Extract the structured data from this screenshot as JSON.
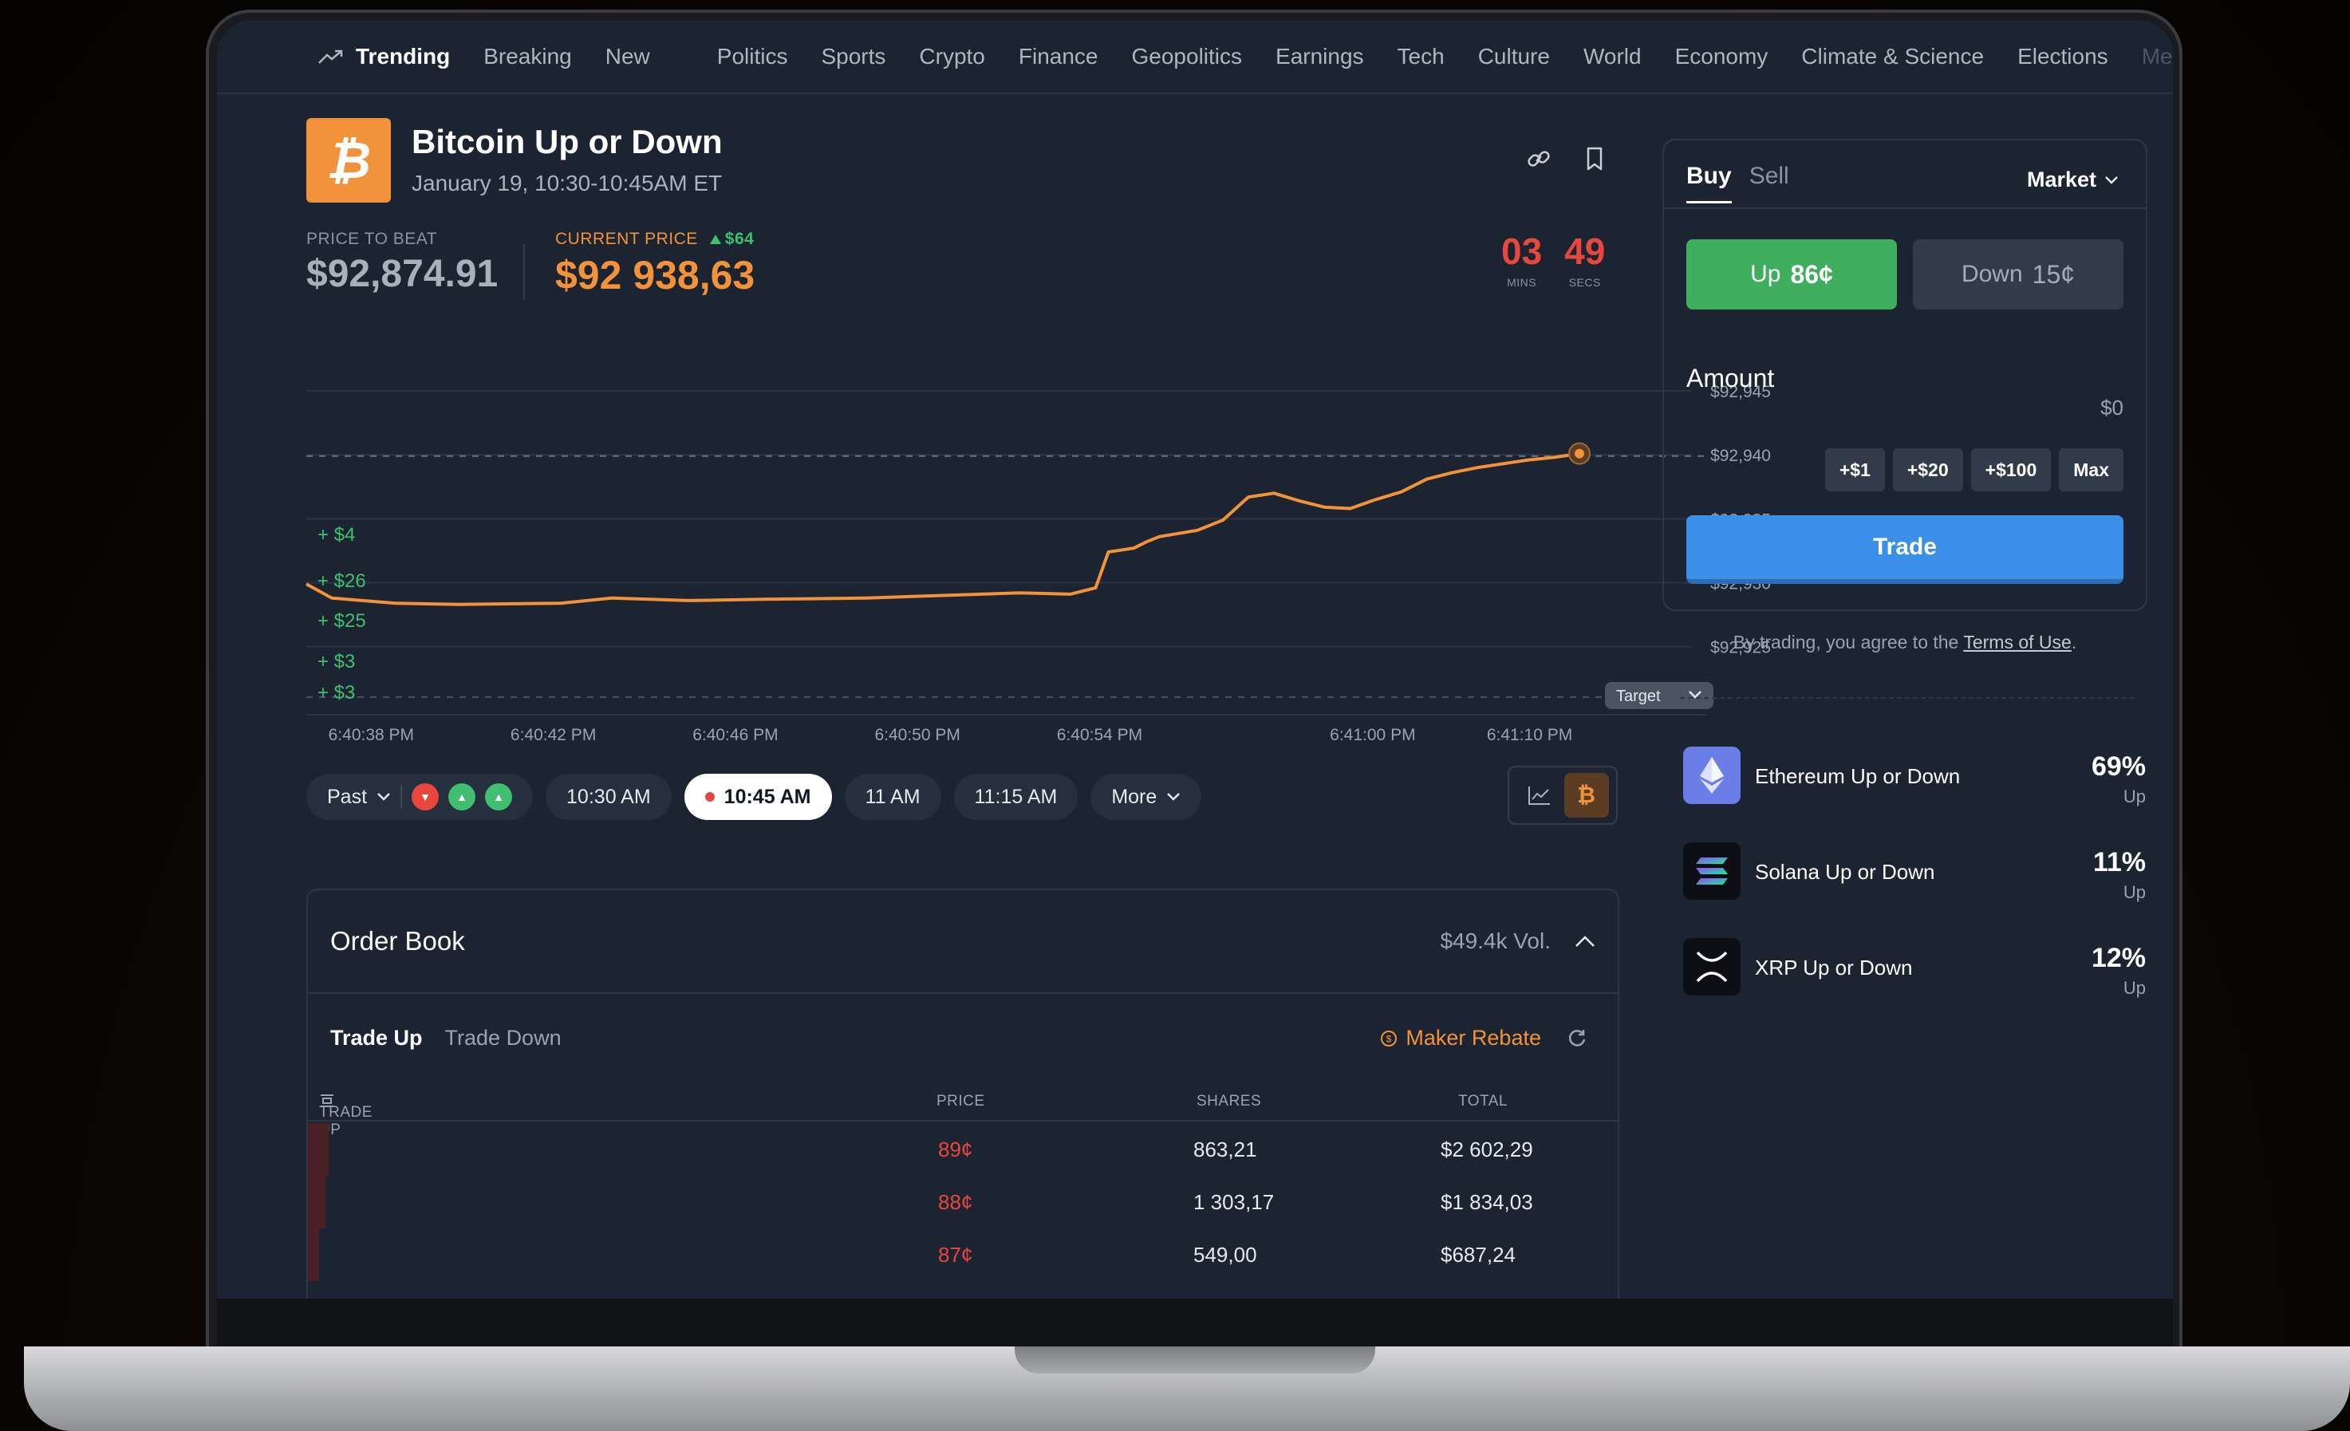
{
  "nav": {
    "items": [
      "Trending",
      "Breaking",
      "New",
      "Politics",
      "Sports",
      "Crypto",
      "Finance",
      "Geopolitics",
      "Earnings",
      "Tech",
      "Culture",
      "World",
      "Economy",
      "Climate & Science",
      "Elections",
      "Me"
    ]
  },
  "market": {
    "title": "Bitcoin Up or Down",
    "subtitle": "January 19, 10:30-10:45AM ET",
    "logo_glyph": "₿",
    "price_to_beat_label": "PRICE TO BEAT",
    "price_to_beat": "$92,874.91",
    "current_price_label": "CURRENT PRICE",
    "current_delta": "$64",
    "current_price": "$92 938,63",
    "countdown": {
      "mins": "03",
      "mins_label": "MINS",
      "secs": "49",
      "secs_label": "SECS"
    }
  },
  "chart_data": {
    "type": "line",
    "y_ticks": [
      "$92,945",
      "$92,940",
      "$92,935",
      "$92,930",
      "$92,925"
    ],
    "y_tick_values": [
      92945,
      92940,
      92935,
      92930,
      92925
    ],
    "x_ticks": [
      "6:40:38 PM",
      "6:40:42 PM",
      "6:40:46 PM",
      "6:40:50 PM",
      "6:40:54 PM",
      "6:41:00 PM",
      "6:41:10 PM"
    ],
    "target_label": "Target",
    "trade_labels": [
      "+ $4",
      "+ $26",
      "+ $25",
      "+ $3",
      "+ $3"
    ],
    "series": [
      {
        "color": "#f2923a",
        "x": [
          0,
          0.02,
          0.07,
          0.12,
          0.2,
          0.24,
          0.3,
          0.36,
          0.44,
          0.5,
          0.56,
          0.6,
          0.62,
          0.63,
          0.65,
          0.66,
          0.67,
          0.7,
          0.72,
          0.74,
          0.76,
          0.78,
          0.8,
          0.82,
          0.84,
          0.86,
          0.88,
          0.9,
          0.92,
          0.94,
          0.96,
          0.98,
          1.0
        ],
        "y": [
          92929.9,
          92928.8,
          92928.4,
          92928.3,
          92928.4,
          92928.8,
          92928.6,
          92928.7,
          92928.8,
          92929.0,
          92929.2,
          92929.1,
          92929.6,
          92932.4,
          92932.7,
          92933.2,
          92933.6,
          92934.1,
          92934.9,
          92936.7,
          92937.0,
          92936.4,
          92935.9,
          92935.8,
          92936.5,
          92937.1,
          92938.1,
          92938.6,
          92939.0,
          92939.3,
          92939.6,
          92939.8,
          92940.1
        ]
      }
    ],
    "ylim": [
      92920.3,
      92946.5
    ],
    "target_value": 92939.9
  },
  "pills": {
    "past_label": "Past",
    "times": [
      "10:30 AM",
      "10:45 AM",
      "11 AM",
      "11:15 AM"
    ],
    "selected": "10:45 AM",
    "more_label": "More"
  },
  "orderbook": {
    "title": "Order Book",
    "volume": "$49.4k Vol.",
    "tab_up": "Trade Up",
    "tab_down": "Trade Down",
    "maker_rebate": "Maker Rebate",
    "col_trade": "TRADE UP",
    "col_price": "PRICE",
    "col_shares": "SHARES",
    "col_total": "TOTAL",
    "rows": [
      {
        "price": "89¢",
        "shares": "863,21",
        "total": "$2 602,29",
        "depth": 0.65
      },
      {
        "price": "88¢",
        "shares": "1 303,17",
        "total": "$1 834,03",
        "depth": 0.55
      },
      {
        "price": "87¢",
        "shares": "549,00",
        "total": "$687,24",
        "depth": 0.35
      }
    ]
  },
  "trade": {
    "tab_buy": "Buy",
    "tab_sell": "Sell",
    "order_type": "Market",
    "up_label": "Up",
    "up_price": "86¢",
    "down_label": "Down",
    "down_price": "15¢",
    "amount_label": "Amount",
    "amount_value": "$0",
    "quick": [
      "+$1",
      "+$20",
      "+$100",
      "Max"
    ],
    "trade_button": "Trade",
    "terms_prefix": "By trading, you agree to the",
    "terms_link": "Terms of Use"
  },
  "related": [
    {
      "name": "Ethereum Up or Down",
      "pct": "69%",
      "sub": "Up",
      "icon": "ethereum-icon",
      "color": "#6b7ee8"
    },
    {
      "name": "Solana Up or Down",
      "pct": "11%",
      "sub": "Up",
      "icon": "solana-icon",
      "color": "#0d0f14"
    },
    {
      "name": "XRP Up or Down",
      "pct": "12%",
      "sub": "Up",
      "icon": "xrp-icon",
      "color": "#0d0f14"
    }
  ]
}
